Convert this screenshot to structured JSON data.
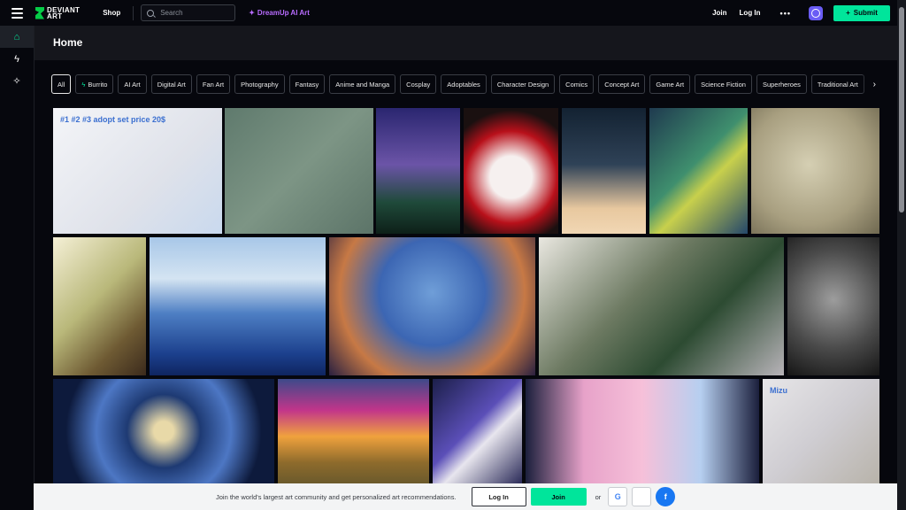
{
  "topbar": {
    "logo_line1": "DEVIANT",
    "logo_line2": "ART",
    "shop_label": "Shop",
    "search_placeholder": "Search",
    "dreamup_label": "DreamUp AI Art",
    "join_label": "Join",
    "login_label": "Log In",
    "more_label": "•••",
    "submit_label": "Submit"
  },
  "sidebar": {
    "items": [
      {
        "icon": "home-icon",
        "glyph": "⌂"
      },
      {
        "icon": "bolt-icon",
        "glyph": "ϟ"
      },
      {
        "icon": "dreamup-icon",
        "glyph": "✧"
      }
    ]
  },
  "header": {
    "title": "Home"
  },
  "chips": [
    "All",
    "Burrito",
    "AI Art",
    "Digital Art",
    "Fan Art",
    "Photography",
    "Fantasy",
    "Anime and Manga",
    "Cosplay",
    "Adoptables",
    "Character Design",
    "Comics",
    "Concept Art",
    "Game Art",
    "Science Fiction",
    "Superheroes",
    "Traditional Art"
  ],
  "tiles": [
    {
      "name": "adopt-set-art",
      "bg": "linear-gradient(135deg,#f4f5f8,#dfe2ea 60%,#c9d9ee)",
      "text": "#1 #2 #3 adopt set price 20$"
    },
    {
      "name": "fairy-deer-art",
      "bg": "linear-gradient(135deg,#5f7a6d,#7d9585 50%,#5c7468)",
      "text": ""
    },
    {
      "name": "forest-lake-art",
      "bg": "linear-gradient(180deg,#2a2670,#6b54a7 45%,#1f4a3a 75%,#0d1f18)",
      "text": ""
    },
    {
      "name": "roses-girl-art",
      "bg": "radial-gradient(circle at 50% 55%,#f6f0ef 25%,#b8101a 55%,#1a1010 80%)",
      "text": ""
    },
    {
      "name": "cloud-girl-art",
      "bg": "linear-gradient(180deg,#132232,#2f4257 45%,#e8c89f 80%,#f1d7b4)",
      "text": ""
    },
    {
      "name": "lizard-warrior-art",
      "bg": "linear-gradient(135deg,#1f3a4f,#3f8f6e 45%,#c8d04c 60%,#24476a)",
      "text": ""
    },
    {
      "name": "polar-bear-art",
      "bg": "radial-gradient(circle at 45% 45%,#d5cfb3,#a89f80 60%,#6f6850)",
      "text": ""
    },
    {
      "name": "window-girl-art",
      "bg": "linear-gradient(135deg,#f5f0d6,#b9b87a 45%,#6e5a33 75%,#3b2a1c)",
      "text": ""
    },
    {
      "name": "ocean-waves-art",
      "bg": "linear-gradient(180deg,#a8c7e8,#d4e4f2 30%,#4e7fc4 55%,#1b3f8c 85%,#0f2560)",
      "text": ""
    },
    {
      "name": "blue-face-art",
      "bg": "radial-gradient(circle at 50% 40%,#6f9ed8,#3c66b3 40%,#c77945 70%,#2a2040)",
      "text": ""
    },
    {
      "name": "cosplay-selfie-photo",
      "bg": "linear-gradient(135deg,#e9e7e0,#6d7a62 40%,#2d4b32 65%,#b7b3b8)",
      "text": ""
    },
    {
      "name": "portrait-bw-photo",
      "bg": "radial-gradient(circle at 50% 45%,#9d9d9d,#4b4b4b 55%,#151515)",
      "text": ""
    },
    {
      "name": "fractal-art",
      "bg": "radial-gradient(circle at 50% 50%,#e8d9a8 8%,#1e3a73 30%,#4d77c4 55%,#0d1a3c 80%)",
      "text": ""
    },
    {
      "name": "sunset-painting-art",
      "bg": "linear-gradient(180deg,#3d4a8a,#c2358a 30%,#f0a23d 55%,#8e6b2c 80%,#6b5a2c)",
      "text": ""
    },
    {
      "name": "raven-art",
      "bg": "linear-gradient(135deg,#1c1f4a,#5b4fb8 45%,#e8e6ee 60%,#2a2a58)",
      "text": ""
    },
    {
      "name": "dress-designs-art",
      "bg": "linear-gradient(90deg,#1b1f3c,#e7a2c9 25%,#f6c0d9 50%,#b6cff0 75%,#1b1f3c)",
      "text": ""
    },
    {
      "name": "character-sheet-art",
      "bg": "linear-gradient(135deg,#e7e6e8,#cfcdd2 50%,#b8b3aa)",
      "text": "Mizu"
    }
  ],
  "bottombar": {
    "message": "Join the world's largest art community and get personalized art recommendations.",
    "login_label": "Log In",
    "join_label": "Join",
    "or_label": "or",
    "google_glyph": "G",
    "apple_glyph": "",
    "facebook_glyph": "f"
  }
}
